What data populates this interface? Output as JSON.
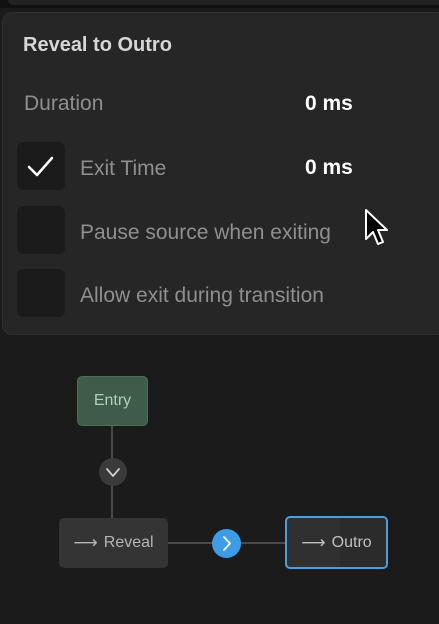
{
  "inspector": {
    "title": "Reveal to Outro",
    "duration_label": "Duration",
    "duration_value": "0 ms",
    "exit_time_label": "Exit Time",
    "exit_time_value": "0 ms",
    "exit_time_checked": true,
    "pause_source_label": "Pause source when exiting",
    "pause_source_checked": false,
    "allow_exit_label": "Allow exit during transition",
    "allow_exit_checked": false
  },
  "graph": {
    "entry_label": "Entry",
    "reveal_label": "Reveal",
    "outro_label": "Outro",
    "arrow_glyph": "⟶",
    "accent_color": "#3d9ce8",
    "entry_color": "#3d5c49"
  }
}
